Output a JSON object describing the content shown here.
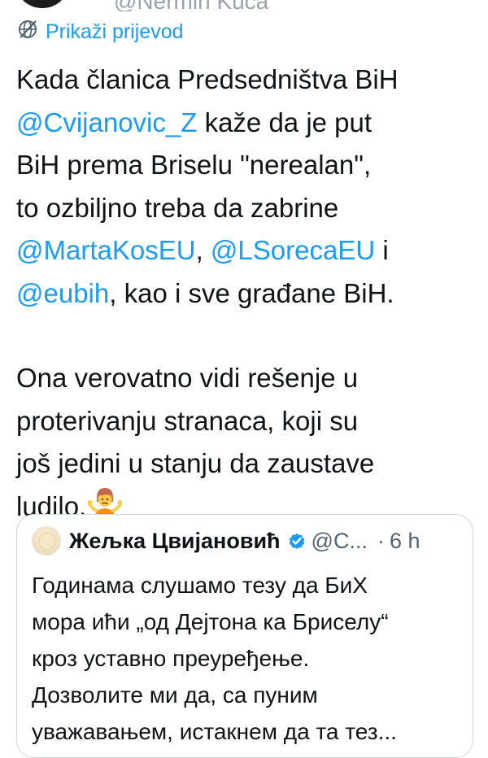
{
  "top": {
    "handle": "@Nermin Kuča"
  },
  "translate": {
    "label": "Prikaži prijevod"
  },
  "tweet": {
    "p1": {
      "line1": "Kada članica Predsedništva BiH",
      "mention1": "@Cvijanovic_Z",
      "line2_rest": " kaže da je put",
      "line3": "BiH prema Briselu \"nerealan\",",
      "line4": "to ozbiljno treba da zabrine",
      "mention2": "@MartaKosEU",
      "sep1": ", ",
      "mention3": "@LSorecaEU",
      "sep2": " i",
      "mention4": "@eubih",
      "line6_rest": ", kao i sve građane BiH."
    },
    "p2": {
      "line1": "Ona verovatno vidi rešenje u",
      "line2": "proterivanju stranaca, koji su",
      "line3": "još jedini u stanju da zaustave",
      "line4": "ludilo."
    },
    "emoji": "person-shrugging-icon"
  },
  "quote": {
    "name": "Жељка Цвијановић",
    "handle": "@C...",
    "dot": "·",
    "time": "6 h",
    "lines": [
      "Годинама слушамо тезу да БиХ",
      "мора ићи „од Дејтона ка Бриселу“",
      "кроз уставно преуређење.",
      "Дозволите ми да, са пуним",
      "уважавањем, истакнем да та тез..."
    ]
  },
  "colors": {
    "link": "#1d9bf0",
    "text": "#0f1419",
    "muted": "#536471",
    "border": "#cfd9de"
  }
}
